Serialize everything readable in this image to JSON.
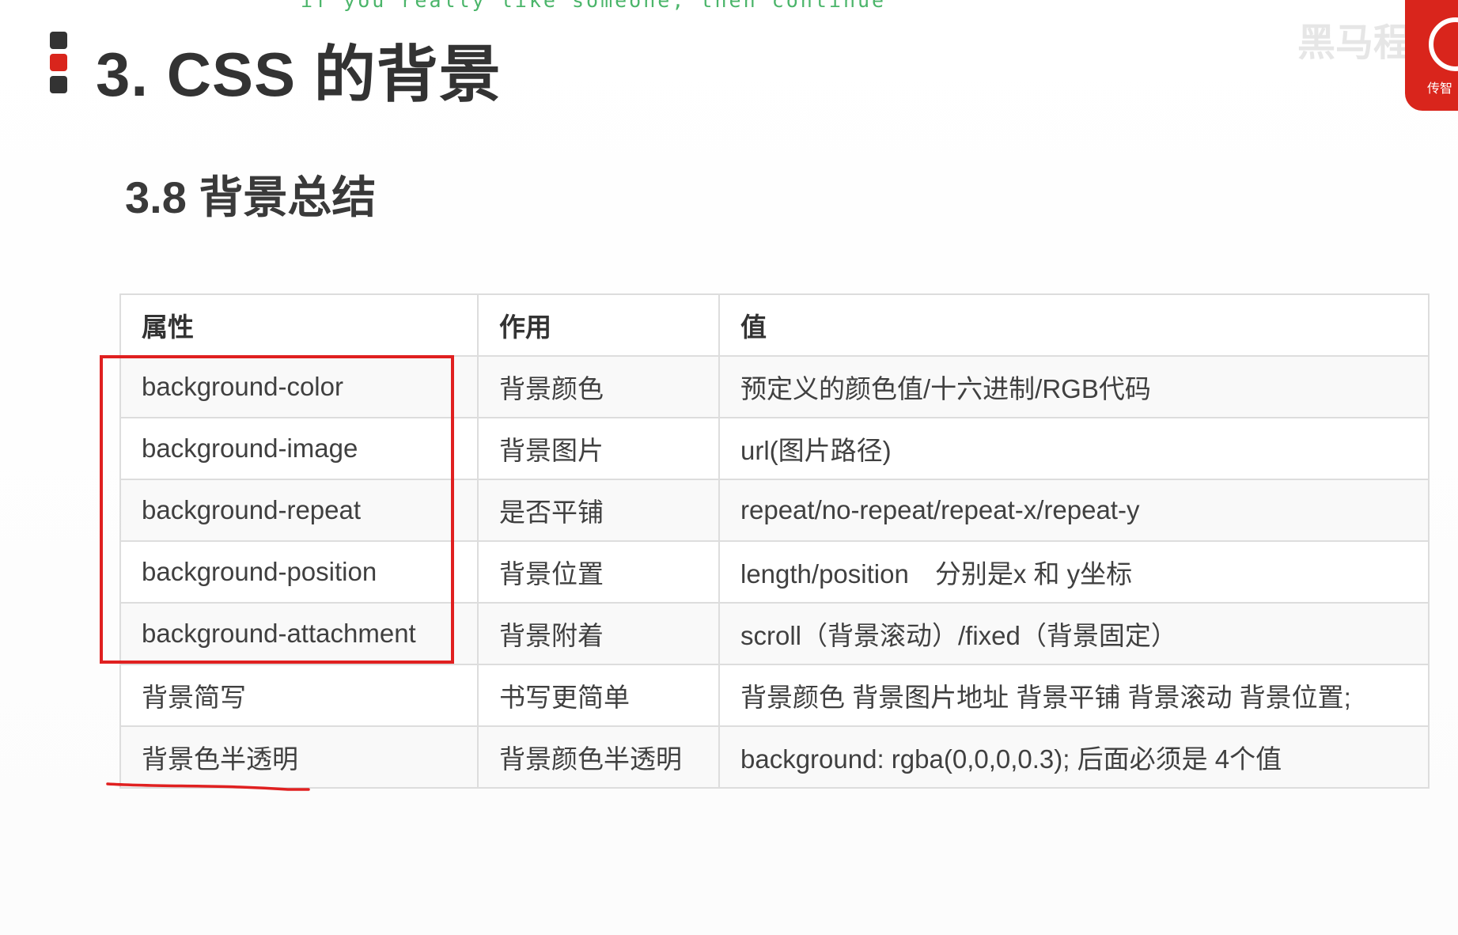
{
  "overlay": {
    "subtitle_text": "if you really like someone, then continue"
  },
  "header": {
    "title": "3. CSS 的背景",
    "subtitle": "3.8 背景总结"
  },
  "branding": {
    "logo_text": "传智",
    "watermark_text": "黑马程序",
    "logo_color": "#d9251c"
  },
  "table": {
    "headers": [
      "属性",
      "作用",
      "值"
    ],
    "rows": [
      [
        "background-color",
        "背景颜色",
        "预定义的颜色值/十六进制/RGB代码"
      ],
      [
        "background-image",
        "背景图片",
        "url(图片路径)"
      ],
      [
        "background-repeat",
        "是否平铺",
        "repeat/no-repeat/repeat-x/repeat-y"
      ],
      [
        "background-position",
        "背景位置",
        "length/position　分别是x  和 y坐标"
      ],
      [
        "background-attachment",
        "背景附着",
        "scroll（背景滚动）/fixed（背景固定）"
      ],
      [
        "背景简写",
        "书写更简单",
        "背景颜色 背景图片地址 背景平铺 背景滚动 背景位置;"
      ],
      [
        "背景色半透明",
        "背景颜色半透明",
        "background: rgba(0,0,0,0.3);   后面必须是 4个值"
      ]
    ]
  },
  "annotations": {
    "highlight_color": "#e02020"
  }
}
